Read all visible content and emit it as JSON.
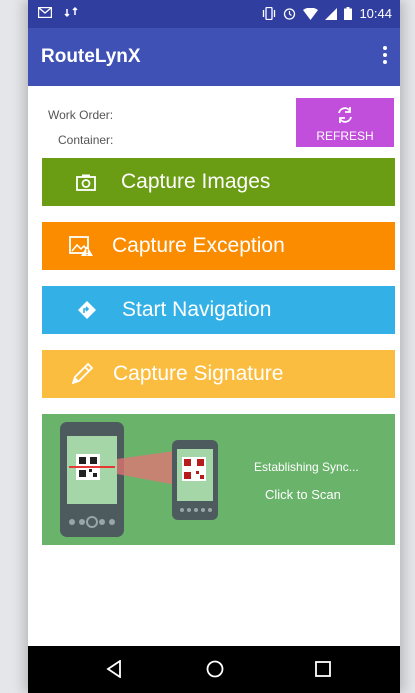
{
  "status_bar": {
    "time": "10:44",
    "icons": [
      "gmail-icon",
      "sync-icon",
      "vibrate-icon",
      "alarm-icon",
      "wifi-icon",
      "signal-icon",
      "battery-icon"
    ]
  },
  "app_bar": {
    "title": "RouteLynX"
  },
  "info": {
    "work_order_label": "Work Order:",
    "container_label": "Container:"
  },
  "refresh": {
    "label": "REFRESH"
  },
  "buttons": [
    {
      "label": "Capture Images",
      "icon": "camera-icon",
      "color": "#6a9c14"
    },
    {
      "label": "Capture Exception",
      "icon": "image-warning-icon",
      "color": "#fb8c00"
    },
    {
      "label": "Start Navigation",
      "icon": "navigation-icon",
      "color": "#33b1e6"
    },
    {
      "label": "Capture Signature",
      "icon": "pencil-icon",
      "color": "#fbbd3f"
    }
  ],
  "scan": {
    "status": "Establishing Sync...",
    "prompt": "Click to Scan"
  },
  "colors": {
    "status_bar": "#303f9f",
    "app_bar": "#3f51b5",
    "refresh": "#c24fdb",
    "scan_panel": "#6ab36b"
  }
}
